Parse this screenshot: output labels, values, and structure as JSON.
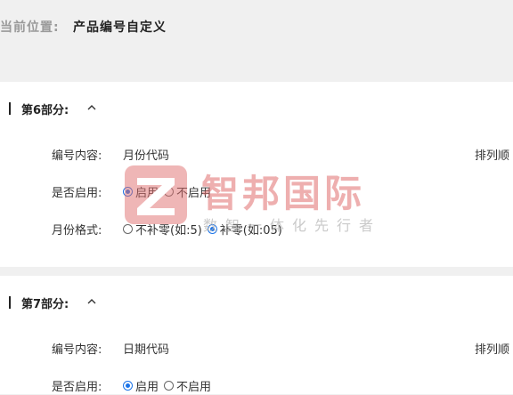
{
  "breadcrumb": {
    "label": "当前位置:",
    "value": "产品编号自定义"
  },
  "sections": [
    {
      "title": "第6部分:",
      "content_label": "编号内容:",
      "content_value": "月份代码",
      "order_label": "排列顺",
      "enable_label": "是否启用:",
      "enable_on": "启用",
      "enable_off": "不启用",
      "format_label": "月份格式:",
      "format_no_pad": "不补零(如:5)",
      "format_pad": "补零(如:05)"
    },
    {
      "title": "第7部分:",
      "content_label": "编号内容:",
      "content_value": "日期代码",
      "order_label": "排列顺",
      "enable_label": "是否启用:",
      "enable_on": "启用",
      "enable_off": "不启用"
    }
  ],
  "watermark": {
    "title": "智邦国际",
    "subtitle": "数智一体化先行者"
  },
  "colors": {
    "accent": "#1a73e8",
    "watermark": "#e06e6e"
  }
}
